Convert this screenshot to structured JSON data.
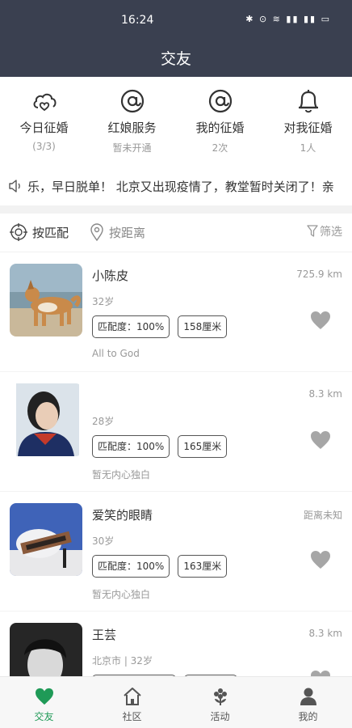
{
  "status": {
    "time": "16:24",
    "icons_text": "✱ ⊙ ≋ ▮▮ ▮▮ ▭"
  },
  "header": {
    "title": "交友"
  },
  "quick_actions": [
    {
      "label": "今日征婚",
      "sub": "(3/3)",
      "icon": "heart-cloud-icon"
    },
    {
      "label": "红娘服务",
      "sub": "暂未开通",
      "icon": "at-icon"
    },
    {
      "label": "我的征婚",
      "sub": "2次",
      "icon": "at-icon"
    },
    {
      "label": "对我征婚",
      "sub": "1人",
      "icon": "bell-icon"
    }
  ],
  "notice": {
    "text": "乐，早日脱单！  北京又出现疫情了，教堂暂时关闭了！亲"
  },
  "filters": {
    "match": "按匹配",
    "distance": "按距离",
    "screen": "筛选"
  },
  "profiles": [
    {
      "name": "小陈皮",
      "distance": "725.9 km",
      "age": "32岁",
      "match": "匹配度：100%",
      "height": "158厘米",
      "bio": "All to God"
    },
    {
      "name": "",
      "distance": "8.3 km",
      "age": "28岁",
      "match": "匹配度：100%",
      "height": "165厘米",
      "bio": "暂无内心独白"
    },
    {
      "name": "爱笑的眼睛",
      "distance": "距离未知",
      "age": "30岁",
      "match": "匹配度：100%",
      "height": "163厘米",
      "bio": "暂无内心独白"
    },
    {
      "name": "王芸",
      "distance": "8.3 km",
      "age": "北京市 | 32岁",
      "match": "",
      "height": "",
      "bio": ""
    }
  ],
  "tabs": [
    {
      "label": "交友",
      "active": true
    },
    {
      "label": "社区",
      "active": false
    },
    {
      "label": "活动",
      "active": false
    },
    {
      "label": "我的",
      "active": false
    }
  ],
  "colors": {
    "header_bg": "#3a4050",
    "accent": "#1f9a57"
  }
}
